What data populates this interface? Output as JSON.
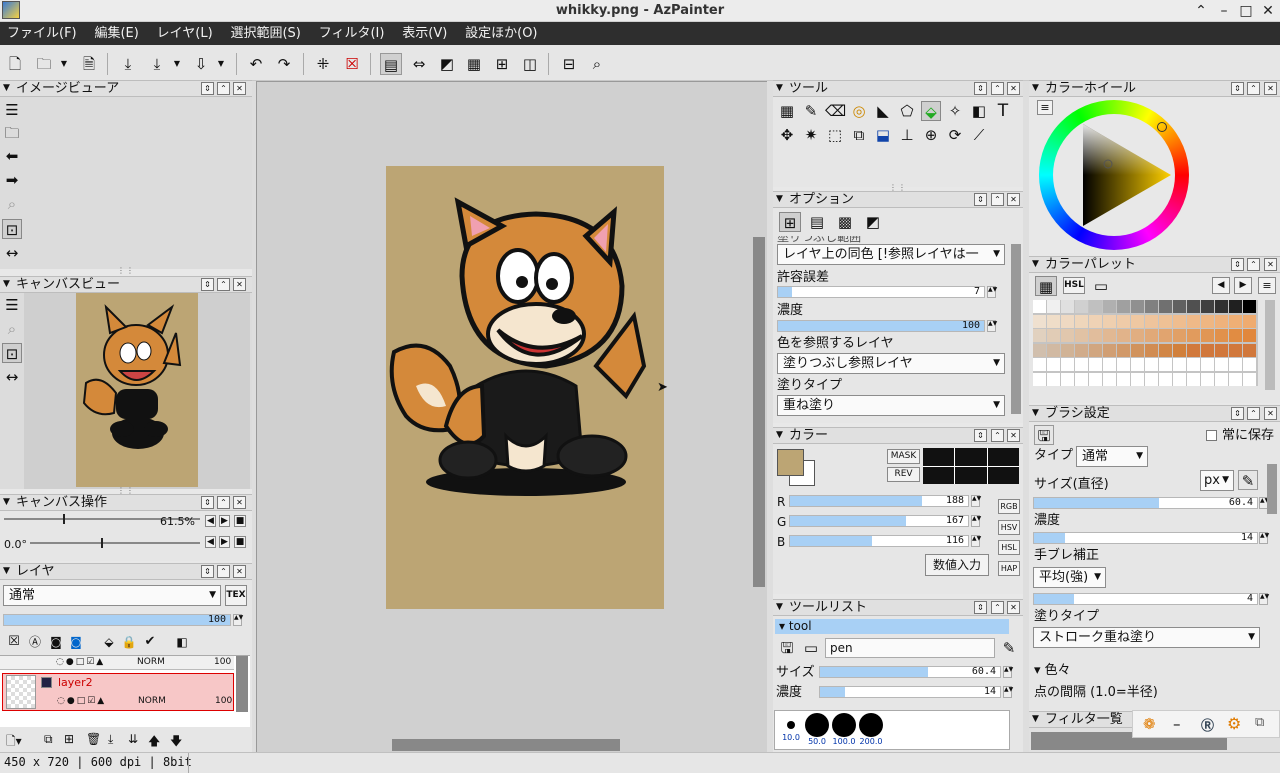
{
  "window": {
    "title": "whikky.png - AzPainter"
  },
  "menu": [
    "ファイル(F)",
    "編集(E)",
    "レイヤ(L)",
    "選択範囲(S)",
    "フィルタ(I)",
    "表示(V)",
    "設定ほか(O)"
  ],
  "toolbar": {
    "icons": [
      "new-file-icon",
      "open-folder-icon",
      "dropdown-icon",
      "recent-file-icon",
      "save-icon",
      "save-as-icon",
      "dropdown-icon",
      "export-icon",
      "dropdown-icon",
      "undo-icon",
      "redo-icon",
      "deselect-icon",
      "clear-selection-icon",
      "layout-icon",
      "fit-width-icon",
      "toggle-bg-icon",
      "grid-icon",
      "subgrid-icon",
      "frame-icon",
      "split-grid-icon",
      "zoom-icon"
    ]
  },
  "panels": {
    "image_viewer": {
      "title": "イメージビューア"
    },
    "canvas_view": {
      "title": "キャンバスビュー"
    },
    "canvas_ops": {
      "title": "キャンバス操作",
      "zoom": "61.5%",
      "angle": "0.0°"
    },
    "layer": {
      "title": "レイヤ",
      "blend_mode": "通常",
      "tex_label": "TEX",
      "opacity": "100",
      "layers": [
        {
          "name": "",
          "mode": "NORM",
          "opacity": "100"
        },
        {
          "name": "layer2",
          "mode": "NORM",
          "opacity": "100"
        }
      ]
    },
    "tool": {
      "title": "ツール"
    },
    "option": {
      "title": "オプション",
      "cut_label": "塗りつぶし範囲",
      "fill_range": "レイヤ上の同色 [!参照レイヤは一",
      "tolerance_label": "許容誤差",
      "tolerance": "7",
      "density_label": "濃度",
      "density": "100",
      "ref_layer_label": "色を参照するレイヤ",
      "ref_layer": "塗りつぶし参照レイヤ",
      "paint_type_label": "塗りタイプ",
      "paint_type": "重ね塗り"
    },
    "color": {
      "title": "カラー",
      "mask_label": "MASK",
      "rev_label": "REV",
      "fg": "#bca574",
      "r": "188",
      "g": "167",
      "b": "116",
      "modes": [
        "RGB",
        "HSV",
        "HSL",
        "HAP"
      ],
      "numeric_input": "数値入力"
    },
    "tool_list": {
      "title": "ツールリスト",
      "group": "tool",
      "tool_name": "pen",
      "size_label": "サイズ",
      "size": "60.4",
      "density_label": "濃度",
      "density": "14",
      "presets": [
        "10.0",
        "50.0",
        "100.0",
        "200.0"
      ]
    },
    "color_wheel": {
      "title": "カラーホイール"
    },
    "palette": {
      "title": "カラーパレット"
    },
    "brush": {
      "title": "ブラシ設定",
      "always_save": "常に保存",
      "type_label": "タイプ",
      "type": "通常",
      "unit": "px",
      "size_label": "サイズ(直径)",
      "size": "60.4",
      "density_label": "濃度",
      "density": "14",
      "stabilizer_label": "手ブレ補正",
      "stabilizer": "平均(強)",
      "stabilizer_val": "4",
      "paint_type_label": "塗りタイプ",
      "paint_type": "ストローク重ね塗り",
      "misc_label": "色々",
      "spacing_label": "点の間隔 (1.0=半径)"
    },
    "filter": {
      "title": "フィルタ一覧"
    }
  },
  "status": {
    "text": "450 x 720 | 600 dpi | 8bit"
  },
  "colors": {
    "canvas_bg": "#bca574",
    "layer_selected": "#f7c7c7"
  }
}
